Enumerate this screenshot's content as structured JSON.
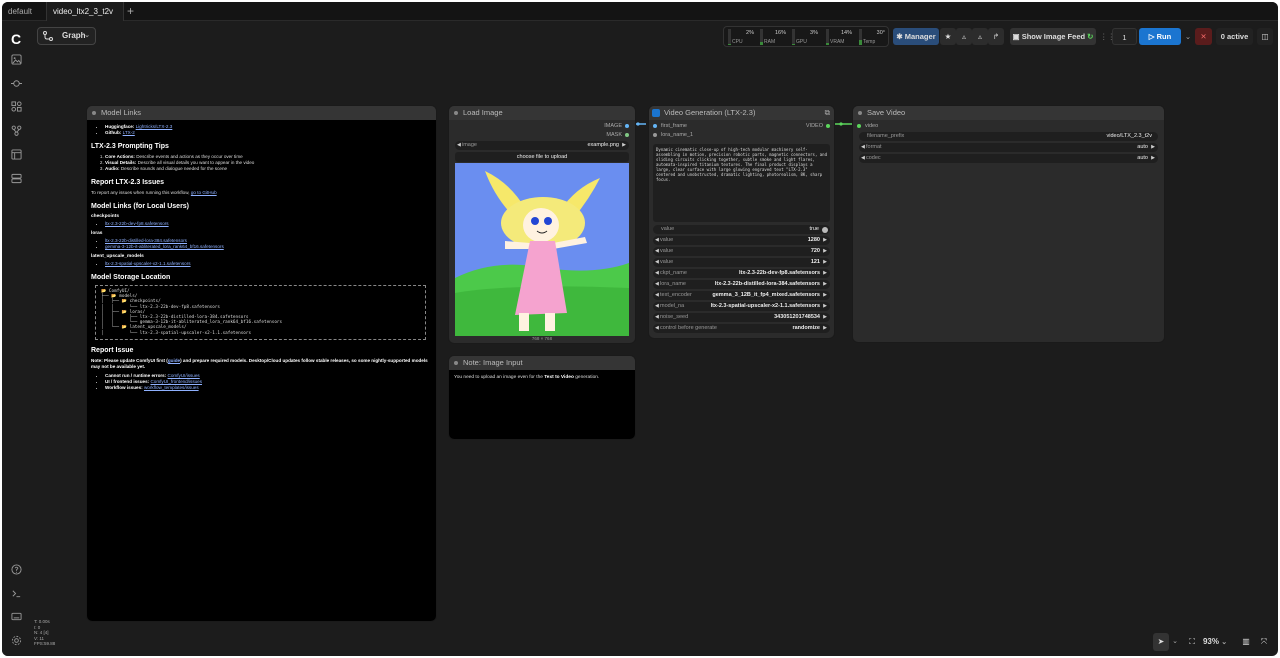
{
  "tabs": [
    {
      "label": "default"
    },
    {
      "label": "video_ltx2_3_t2v"
    }
  ],
  "toolbar": {
    "graph_label": "Graph",
    "monitor": [
      {
        "label": "CPU",
        "pct": "2%",
        "level": 0.02
      },
      {
        "label": "RAM",
        "pct": "16%",
        "level": 0.16
      },
      {
        "label": "GPU",
        "pct": "3%",
        "level": 0.03
      },
      {
        "label": "VRAM",
        "pct": "14%",
        "level": 0.14
      },
      {
        "label": "Temp",
        "pct": "30°",
        "level": 0.3
      }
    ],
    "manager_label": "Manager",
    "image_feed_label": "Show Image Feed",
    "run_count": "1",
    "run_label": "Run",
    "active_label": "0 active"
  },
  "nodes": {
    "links": {
      "title": "Model Links",
      "hf_label": "Huggingface:",
      "hf_link": "Lightricks/LTX-2.3",
      "gh_label": "Github:",
      "gh_link": "LTX-2",
      "tips_heading": "LTX-2.3 Prompting Tips",
      "tips": [
        {
          "b": "Core Actions:",
          "t": "Describe events and actions as they occur over time"
        },
        {
          "b": "Visual Details:",
          "t": "Describe all visual details you want to appear in the video"
        },
        {
          "b": "Audio:",
          "t": "Describe sounds and dialogue needed for the scene"
        }
      ],
      "report_heading": "Report LTX-2.3 Issues",
      "report_text": "To report any issues when running this workflow,",
      "report_link": "go to GitHub",
      "models_heading": "Model Links (for Local Users)",
      "ckpt_heading": "checkpoints",
      "ckpt_link": "ltx-2.3-22b-dev-fp8.safetensors",
      "loras_heading": "loras",
      "lora_link1": "ltx-2.3-22b-distilled-lora-384.safetensors",
      "lora_link2": "gemma-3-12b-it-abliterated_lora_rank64_bf16.safetensors",
      "upscale_heading": "latent_upscale_models",
      "upscale_link": "ltx-2.3-spatial-upscaler-x2-1.1.safetensors",
      "storage_heading": "Model Storage Location",
      "tree": "📂 ComfyUI/\n├── 📂 models/\n│   ├── 📂 checkpoints/\n│   │      └── ltx-2.3-22b-dev-fp8.safetensors\n│   ├── 📂 loras/\n│   │      ├── ltx-2.3-22b-distilled-lora-384.safetensors\n│   │      └── gemma-3-12b-it-abliterated_lora_rank64_bf16.safetensors\n│   └── 📂 latent_upscale_models/\n│          └── ltx-2.3-spatial-upscaler-x2-1.1.safetensors",
      "issue_heading": "Report Issue",
      "issue_text_1": "Note: Please update ComfyUI first (",
      "issue_guide": "guide",
      "issue_text_2": ") and prepare required models. Desktop/Cloud updates follow stable releases, so some nightly-supported models may not be available yet.",
      "issue_items": [
        {
          "b": "Cannot run / runtime errors:",
          "link": "ComfyUI/issues"
        },
        {
          "b": "UI / frontend issues:",
          "link": "ComfyUI_frontend/issues"
        },
        {
          "b": "Workflow issues:",
          "link": "workflow_templates/issues"
        }
      ]
    },
    "load": {
      "title": "Load Image",
      "out_image": "IMAGE",
      "out_mask": "MASK",
      "image_label": "image",
      "image_value": "example.png",
      "upload_label": "choose file to upload",
      "size_label": "768 × 768"
    },
    "video": {
      "title": "Video Generation (LTX-2.3)",
      "in_first": "first_frame",
      "in_lora": "lora_name_1",
      "out_video": "VIDEO",
      "prompt": "Dynamic cinematic close-up of high-tech modular machinery self-assembling in motion, precision robotic parts, magnetic connectors, and sliding circuits clicking together, subtle smoke and light flares, automata-inspired titanium textures. The final product displays a large, clear surface with large glowing engraved text \"LTX-2.3\" centered and unobstructed, dramatic lighting, photorealism, 8K, sharp focus.",
      "widgets": [
        {
          "label": "value",
          "value": "true",
          "type": "toggle"
        },
        {
          "label": "value",
          "value": "1280"
        },
        {
          "label": "value",
          "value": "720"
        },
        {
          "label": "value",
          "value": "121"
        },
        {
          "label": "ckpt_name",
          "value": "ltx-2.3-22b-dev-fp8.safetensors"
        },
        {
          "label": "lora_name",
          "value": "ltx-2.3-22b-distilled-lora-384.safetensors"
        },
        {
          "label": "text_encoder",
          "value": "gemma_3_12B_it_fp4_mixed.safetensors"
        },
        {
          "label": "model_na",
          "value": "ltx-2.3-spatial-upscaler-x2-1.1.safetensors"
        },
        {
          "label": "noise_seed",
          "value": "343051201748534"
        },
        {
          "label": "control before generate",
          "value": "randomize"
        }
      ]
    },
    "note": {
      "title": "Note: Image Input",
      "text_1": "You need to upload an image even for the ",
      "text_b": "Text to Video",
      "text_2": " generation."
    },
    "save": {
      "title": "Save Video",
      "in_video": "video",
      "prefix_label": "filename_prefix",
      "prefix_value": "video/LTX_2.3_t2v",
      "format_label": "format",
      "format_value": "auto",
      "codec_label": "codec",
      "codec_value": "auto"
    }
  },
  "stats": [
    "T: 0.00s",
    "I: 0",
    "N: 4 [4]",
    "V: 11",
    "FPS:59.88"
  ],
  "zoom_label": "93%",
  "colors": {
    "accent": "#1b75d0",
    "image_socket": "#64b5f6",
    "video_socket": "#5cd65c",
    "mask_socket": "#81c784"
  }
}
